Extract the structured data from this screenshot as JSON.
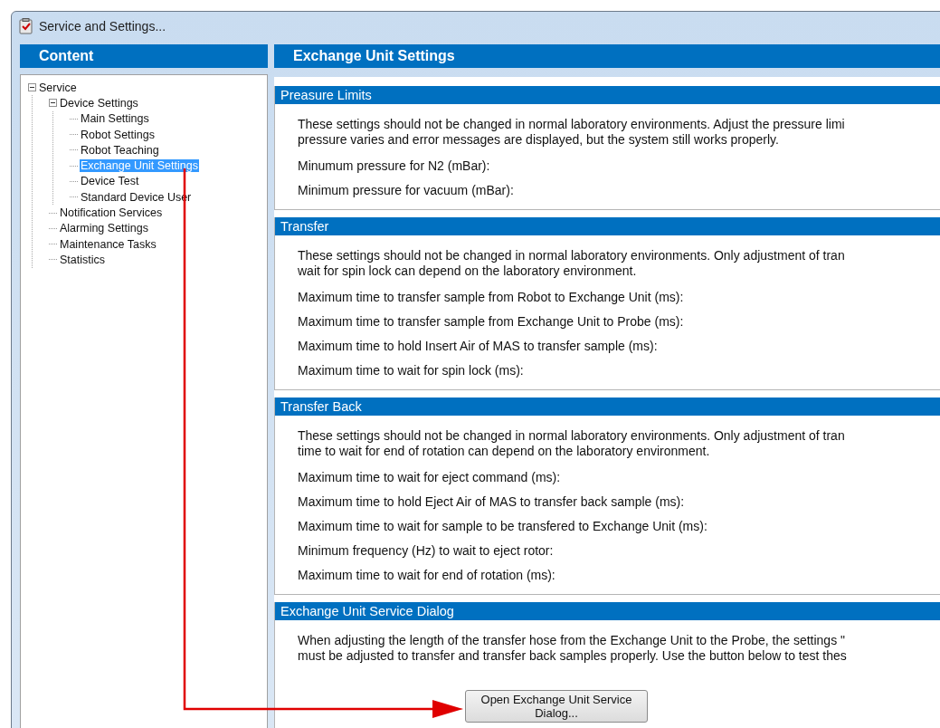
{
  "window": {
    "title": "Service and Settings..."
  },
  "sidebar": {
    "title": "Content",
    "tree": [
      {
        "label": "Service",
        "expanded": true,
        "selected": false,
        "children": [
          {
            "label": "Device Settings",
            "expanded": true,
            "selected": false,
            "children": [
              {
                "label": "Main Settings",
                "selected": false
              },
              {
                "label": "Robot Settings",
                "selected": false
              },
              {
                "label": "Robot Teaching",
                "selected": false
              },
              {
                "label": "Exchange Unit Settings",
                "selected": true
              },
              {
                "label": "Device Test",
                "selected": false
              },
              {
                "label": "Standard Device User",
                "selected": false
              }
            ]
          },
          {
            "label": "Notification Services",
            "selected": false
          },
          {
            "label": "Alarming Settings",
            "selected": false
          },
          {
            "label": "Maintenance Tasks",
            "selected": false
          },
          {
            "label": "Statistics",
            "selected": false
          }
        ]
      }
    ]
  },
  "main": {
    "title": "Exchange Unit Settings",
    "sections": [
      {
        "title": "Preasure Limits",
        "description": [
          "These settings should not be changed in normal laboratory environments. Adjust the pressure limi",
          "pressure varies and error messages are displayed, but the system still works properly."
        ],
        "fields": [
          "Minumum pressure for N2 (mBar):",
          "Minimum pressure for vacuum (mBar):"
        ]
      },
      {
        "title": "Transfer",
        "description": [
          "These settings should not be changed in normal laboratory environments. Only adjustment of tran",
          "wait for spin lock can depend on the laboratory environment."
        ],
        "fields": [
          "Maximum time to transfer sample from Robot to Exchange Unit (ms):",
          "Maximum time to transfer sample from Exchange Unit to Probe (ms):",
          "Maximum time to hold Insert Air of MAS to transfer sample (ms):",
          "Maximum time to wait for spin lock (ms):"
        ]
      },
      {
        "title": "Transfer Back",
        "description": [
          "These settings should not be changed in normal laboratory environments. Only adjustment of tran",
          "time to wait for end of rotation can depend on the laboratory environment."
        ],
        "fields": [
          "Maximum time to wait for eject command (ms):",
          "Maximum time to hold Eject Air of MAS to transfer back sample (ms):",
          "Maximum time to wait for sample to be transfered to Exchange Unit (ms):",
          "Minimum frequency (Hz) to wait to eject rotor:",
          "Maximum time to wait for end of rotation (ms):"
        ]
      },
      {
        "title": "Exchange Unit Service Dialog",
        "description": [
          "When adjusting the length of the transfer hose from the Exchange Unit to the Probe, the settings \"",
          "must be adjusted to transfer and transfer back samples properly. Use the button below to test thes"
        ],
        "button": "Open Exchange Unit Service Dialog..."
      }
    ]
  }
}
